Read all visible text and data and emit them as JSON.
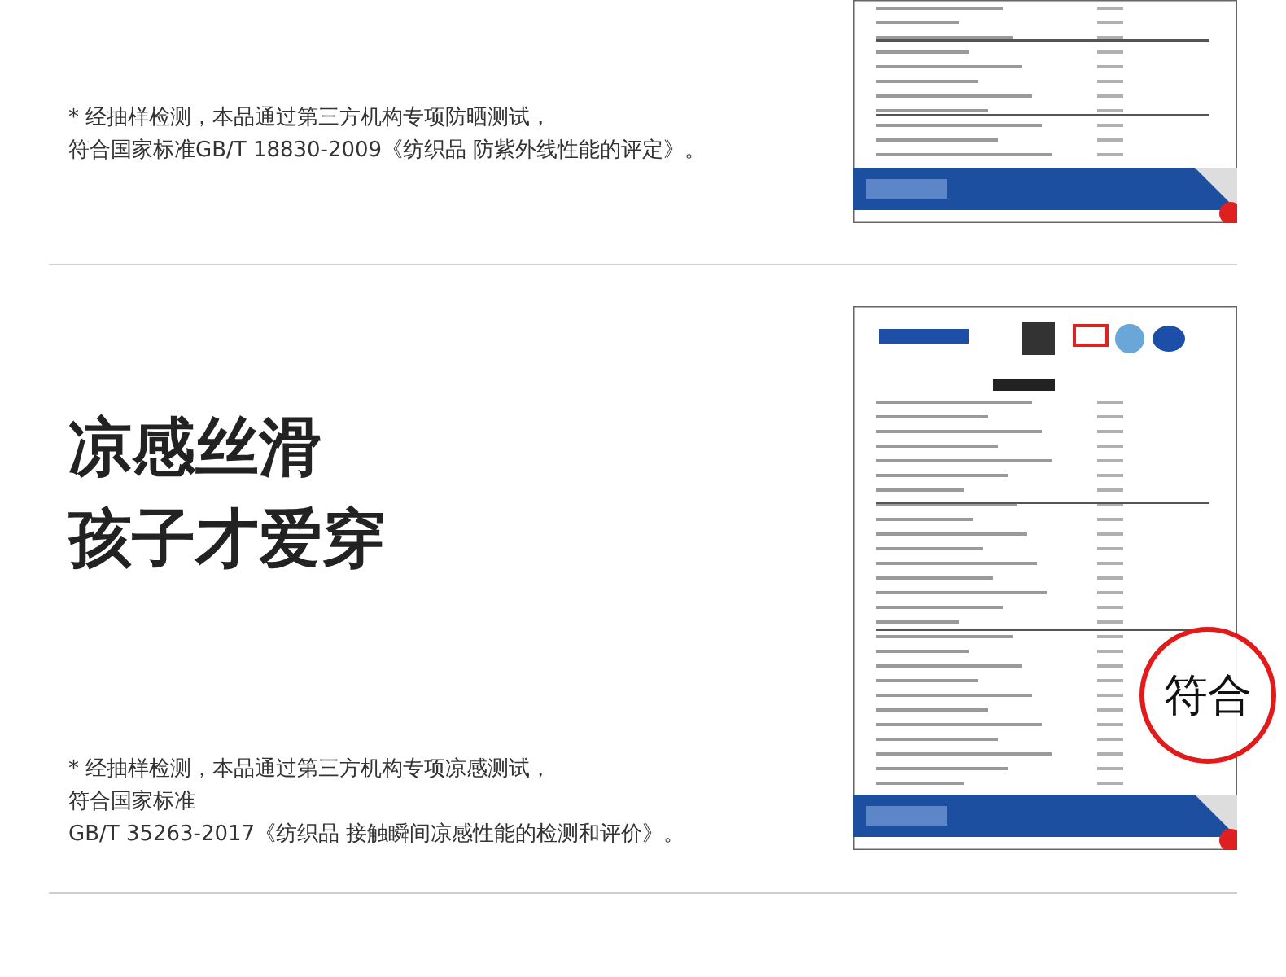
{
  "sections": [
    {
      "note": [
        "* 经抽样检测，本品通过第三方机构专项防晒测试，",
        "符合国家标准GB/T 18830-2009《纺织品 防紫外线性能的评定》。"
      ],
      "report": {
        "kind": "picture"
      }
    },
    {
      "headline": [
        "凉感丝滑",
        "孩子才爱穿"
      ],
      "note": [
        "* 经抽样检测，本品通过第三方机构专项凉感测试，",
        "符合国家标准",
        "GB/T 35263-2017《纺织品 接触瞬间凉感性能的检测和评价》。"
      ],
      "report": {
        "kind": "picture",
        "stamp": "符合"
      }
    }
  ]
}
